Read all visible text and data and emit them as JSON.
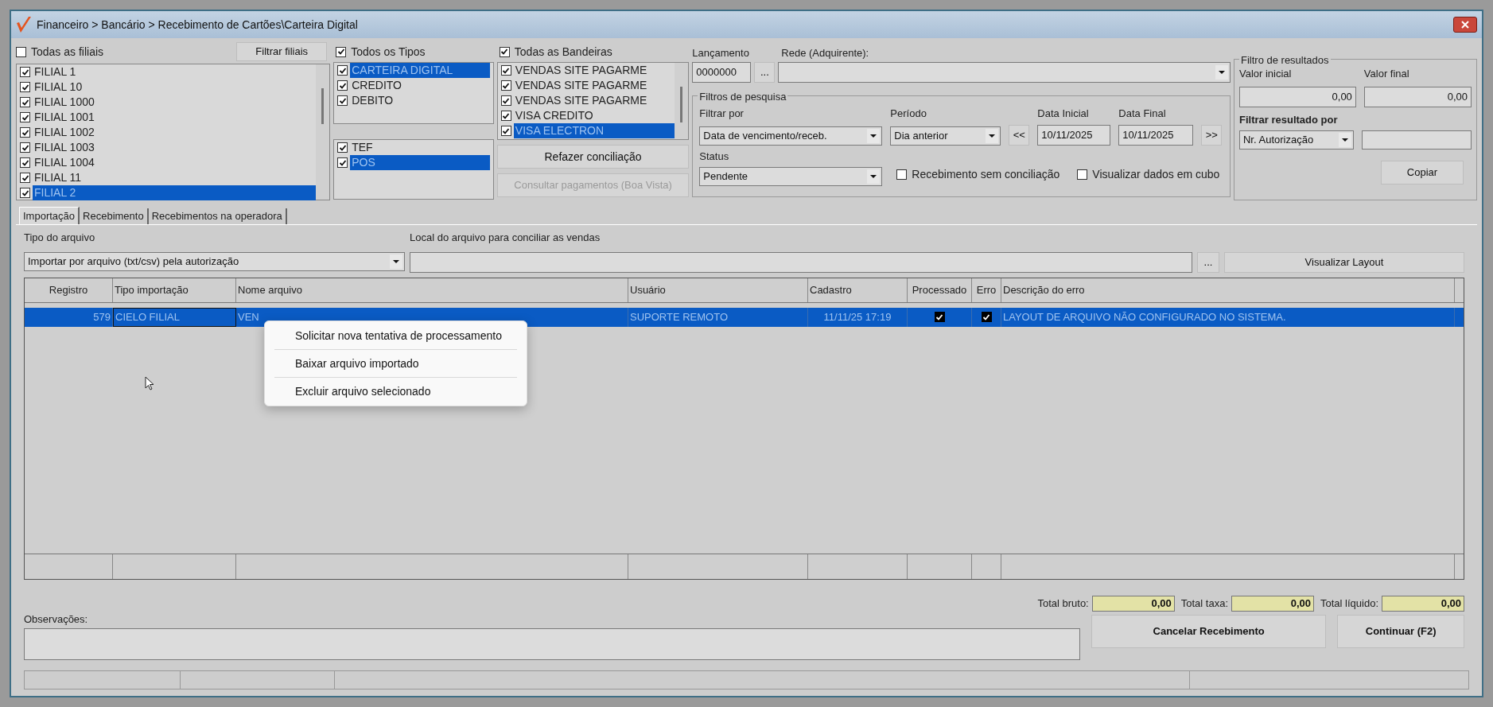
{
  "window": {
    "title": "Financeiro > Bancário > Recebimento de Cartões\\Carteira Digital"
  },
  "branches": {
    "all_label": "Todas as filiais",
    "all_checked": false,
    "filter_button": "Filtrar filiais",
    "items": [
      {
        "label": "FILIAL 1",
        "checked": true,
        "selected": false
      },
      {
        "label": "FILIAL 10",
        "checked": true,
        "selected": false
      },
      {
        "label": "FILIAL 1000",
        "checked": true,
        "selected": false
      },
      {
        "label": "FILIAL 1001",
        "checked": true,
        "selected": false
      },
      {
        "label": "FILIAL 1002",
        "checked": true,
        "selected": false
      },
      {
        "label": "FILIAL 1003",
        "checked": true,
        "selected": false
      },
      {
        "label": "FILIAL 1004",
        "checked": true,
        "selected": false
      },
      {
        "label": "FILIAL 11",
        "checked": true,
        "selected": false
      },
      {
        "label": "FILIAL 2",
        "checked": true,
        "selected": true
      }
    ]
  },
  "types": {
    "all_label": "Todos os Tipos",
    "all_checked": true,
    "items": [
      {
        "label": "CARTEIRA DIGITAL",
        "checked": true,
        "selected": true
      },
      {
        "label": "CREDITO",
        "checked": true,
        "selected": false
      },
      {
        "label": "DEBITO",
        "checked": true,
        "selected": false
      }
    ],
    "modes": [
      {
        "label": "TEF",
        "checked": true,
        "selected": false
      },
      {
        "label": "POS",
        "checked": true,
        "selected": true
      }
    ]
  },
  "brands": {
    "all_label": "Todas as Bandeiras",
    "all_checked": true,
    "items": [
      {
        "label": "VENDAS SITE PAGARME",
        "checked": true,
        "selected": false
      },
      {
        "label": "VENDAS SITE PAGARME",
        "checked": true,
        "selected": false
      },
      {
        "label": "VENDAS SITE PAGARME",
        "checked": true,
        "selected": false
      },
      {
        "label": "VISA CREDITO",
        "checked": true,
        "selected": false
      },
      {
        "label": "VISA ELECTRON",
        "checked": true,
        "selected": true
      }
    ],
    "buttons": [
      {
        "label": "Refazer conciliação",
        "disabled": false
      },
      {
        "label": "Consultar pagamentos (Boa Vista)",
        "disabled": true
      }
    ]
  },
  "launch": {
    "label": "Lançamento",
    "value": "0000000",
    "browse": "...",
    "network_label": "Rede (Adquirente):"
  },
  "search_filters": {
    "legend": "Filtros de pesquisa",
    "filter_label": "Filtrar por",
    "filter_value": "Data de vencimento/receb.",
    "period_label": "Período",
    "period_value": "Dia anterior",
    "prev": "<<",
    "start_label": "Data Inicial",
    "start_value": "10/11/2025",
    "end_label": "Data Final",
    "end_value": "10/11/2025",
    "next": ">>",
    "status_label": "Status",
    "status_value": "Pendente",
    "checkboxes": [
      {
        "label": "Recebimento sem conciliação",
        "checked": false
      },
      {
        "label": "Visualizar dados em cubo",
        "checked": false
      }
    ]
  },
  "result_filter": {
    "legend": "Filtro de resultados",
    "initial_label": "Valor inicial",
    "initial_value": "0,00",
    "final_label": "Valor final",
    "final_value": "0,00",
    "filter_label": "Filtrar resultado por",
    "filter_value": "Nr. Autorização",
    "copy_button": "Copiar"
  },
  "tabs": [
    {
      "label": "Importação",
      "selected": true
    },
    {
      "label": "Recebimento",
      "selected": false
    },
    {
      "label": "Recebimentos na operadora",
      "selected": false
    }
  ],
  "import": {
    "type_label": "Tipo do arquivo",
    "type_value": "Importar por arquivo (txt/csv) pela autorização",
    "location_label": "Local do arquivo para conciliar as vendas",
    "browse": "...",
    "layout_button": "Visualizar Layout"
  },
  "table": {
    "columns": [
      "Registro",
      "Tipo importação",
      "Nome arquivo",
      "Usuário",
      "Cadastro",
      "Processado",
      "Erro",
      "Descrição do erro"
    ],
    "rows": [
      {
        "selected": true,
        "registro": "579",
        "tipo": "CIELO FILIAL",
        "nome": "VEN",
        "usuario": "SUPORTE REMOTO",
        "cadastro": "11/11/25 17:19",
        "processed": true,
        "error": true,
        "descricao": "LAYOUT DE ARQUIVO NÃO CONFIGURADO NO SISTEMA."
      }
    ]
  },
  "context_menu": [
    "Solicitar nova tentativa de processamento",
    "Baixar arquivo importado",
    "Excluir arquivo selecionado"
  ],
  "totals": [
    {
      "label": "Total bruto:",
      "value": "0,00"
    },
    {
      "label": "Total taxa:",
      "value": "0,00"
    },
    {
      "label": "Total líquido:",
      "value": "0,00"
    }
  ],
  "observations_label": "Observações:",
  "actions": [
    "Cancelar Recebimento",
    "Continuar (F2)"
  ]
}
